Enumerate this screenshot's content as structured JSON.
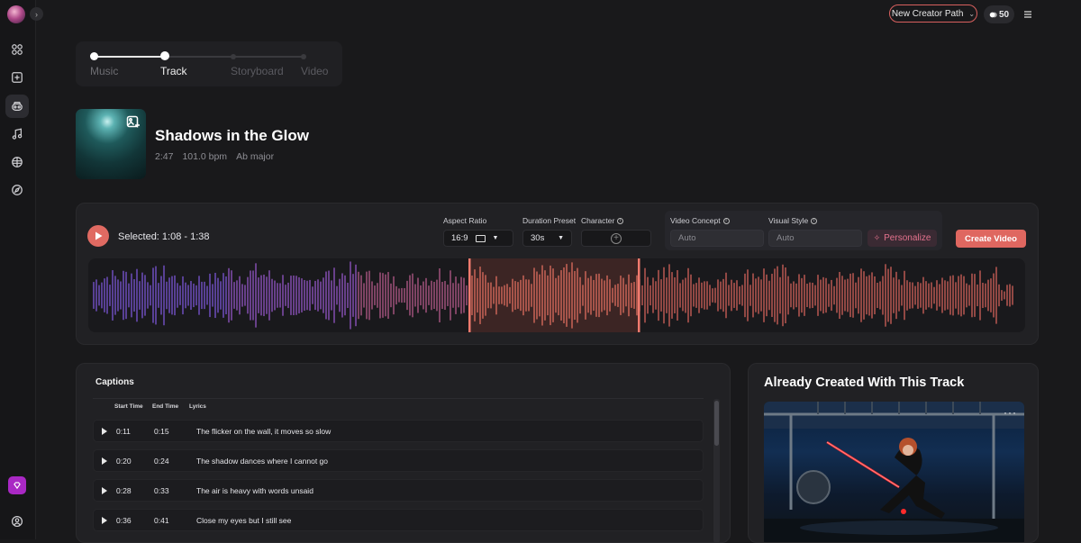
{
  "topbar": {
    "creator_path_label": "New Creator Path",
    "credits": "50"
  },
  "stepper": {
    "steps": [
      "Music",
      "Track",
      "Storyboard",
      "Video"
    ]
  },
  "track": {
    "title": "Shadows in the Glow",
    "duration": "2:47",
    "bpm": "101.0 bpm",
    "key": "Ab major"
  },
  "controls": {
    "selected": "Selected: 1:08 - 1:38",
    "aspect_ratio_label": "Aspect Ratio",
    "aspect_ratio_value": "16:9",
    "duration_label": "Duration Preset",
    "duration_value": "30s",
    "character_label": "Character",
    "concept_label": "Video Concept",
    "concept_value": "Auto",
    "style_label": "Visual Style",
    "style_value": "Auto",
    "personalize_label": "Personalize",
    "create_label": "Create Video"
  },
  "captions": {
    "title": "Captions",
    "headers": {
      "start": "Start Time",
      "end": "End Time",
      "lyrics": "Lyrics"
    },
    "rows": [
      {
        "start": "0:11",
        "end": "0:15",
        "lyric": "The flicker on the wall, it moves so slow"
      },
      {
        "start": "0:20",
        "end": "0:24",
        "lyric": "The shadow dances where I cannot go"
      },
      {
        "start": "0:28",
        "end": "0:33",
        "lyric": "The air is heavy with words unsaid"
      },
      {
        "start": "0:36",
        "end": "0:41",
        "lyric": "Close my eyes but I still see"
      }
    ]
  },
  "created": {
    "title": "Already Created With This Track"
  },
  "colors": {
    "accent": "#df6760",
    "wave_played": "#7b4fc4",
    "wave_rest": "#d8685a",
    "premium": "#a928c4"
  },
  "icons": [
    "grid-icon",
    "plus-square-icon",
    "robot-icon",
    "music-note-icon",
    "brain-icon",
    "compass-icon",
    "gem-icon",
    "user-circle-icon",
    "info-icon",
    "image-plus-icon",
    "sparkle-icon",
    "play-icon"
  ]
}
